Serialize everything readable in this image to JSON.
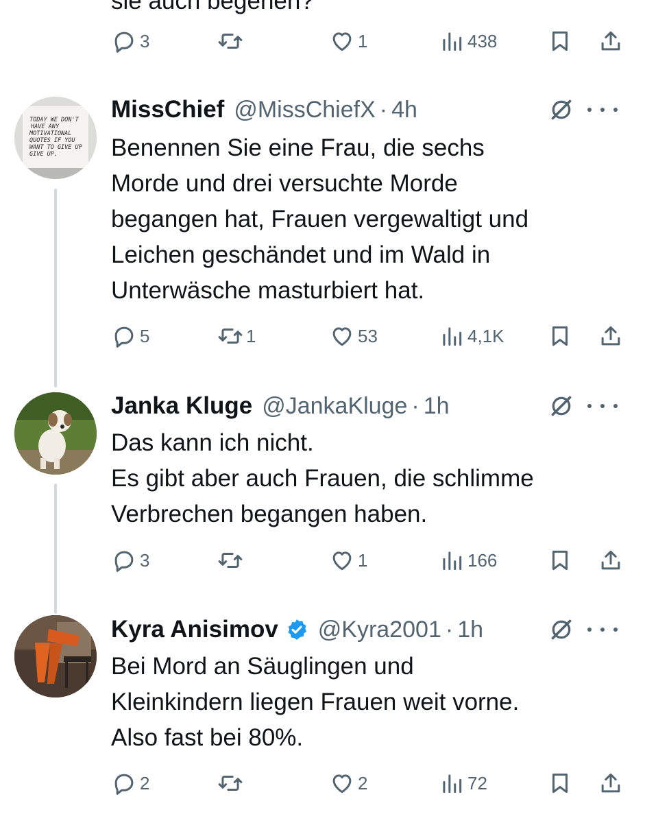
{
  "top_tweet": {
    "partial_text": "sie auch begehen?",
    "actions": {
      "replies": "3",
      "retweets": "",
      "likes": "1",
      "views": "438"
    }
  },
  "tweets": [
    {
      "name": "MissChief",
      "handle": "@MissChiefX",
      "time": "4h",
      "verified": false,
      "avatar_text": "TODAY WE DON'T HAVE ANY MOTIVATIONAL QUOTES IF YOU WANT TO GIVE UP GIVE UP.",
      "text": "Benennen Sie eine Frau, die sechs\nMorde und drei versuchte Morde\nbegangen hat, Frauen vergewaltigt und\nLeichen geschändet und im Wald in\nUnterwäsche masturbiert hat.",
      "actions": {
        "replies": "5",
        "retweets": "1",
        "likes": "53",
        "views": "4,1K"
      }
    },
    {
      "name": "Janka Kluge",
      "handle": "@JankaKluge",
      "time": "1h",
      "verified": false,
      "text": "Das kann ich nicht.\nEs gibt aber auch Frauen, die schlimme\nVerbrechen begangen haben.",
      "actions": {
        "replies": "3",
        "retweets": "",
        "likes": "1",
        "views": "166"
      }
    },
    {
      "name": "Kyra Anisimov",
      "handle": "@Kyra2001",
      "time": "1h",
      "verified": true,
      "text": "Bei Mord an Säuglingen und\nKleinkindern liegen Frauen weit vorne.\nAlso fast bei 80%.",
      "actions": {
        "replies": "2",
        "retweets": "",
        "likes": "2",
        "views": "72"
      }
    }
  ],
  "separator": "·",
  "colors": {
    "text": "#0f1419",
    "secondary": "#536471",
    "thread_line": "#cfd9de",
    "verified": "#1d9bf0"
  },
  "icons": [
    "reply-icon",
    "retweet-icon",
    "like-icon",
    "views-icon",
    "bookmark-icon",
    "share-icon",
    "grok-icon",
    "more-icon",
    "verified-icon"
  ]
}
